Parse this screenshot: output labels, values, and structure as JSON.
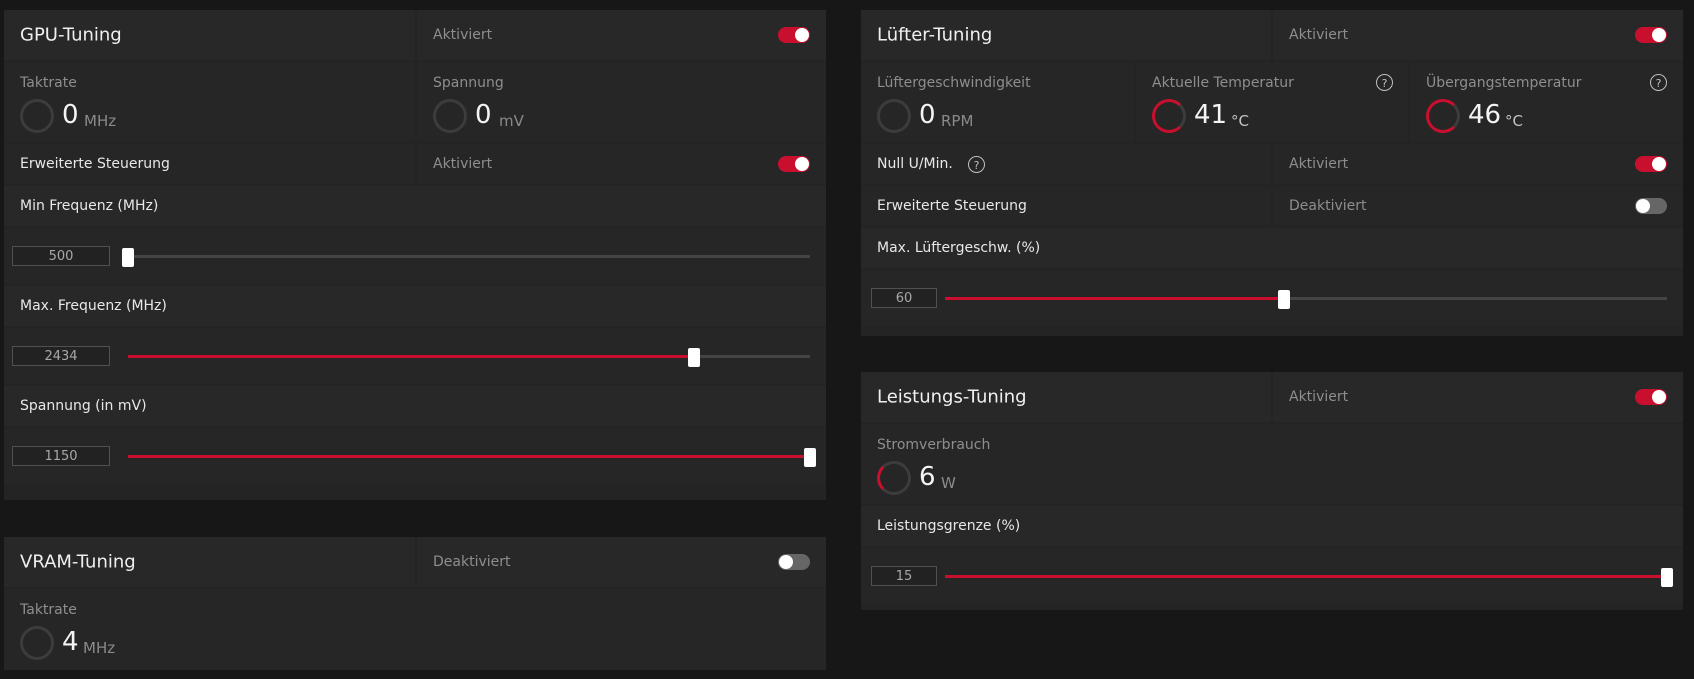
{
  "gpu": {
    "title": "GPU-Tuning",
    "status": "Aktiviert",
    "clock": {
      "label": "Taktrate",
      "value": "0",
      "unit": "MHz"
    },
    "voltage": {
      "label": "Spannung",
      "value": "0",
      "unit": "mV"
    },
    "advanced": {
      "label": "Erweiterte Steuerung",
      "status": "Aktiviert"
    },
    "min_freq": {
      "label": "Min Frequenz (MHz)",
      "value": "500",
      "fill_fraction": 0.0
    },
    "max_freq": {
      "label": "Max. Frequenz (MHz)",
      "value": "2434",
      "fill_fraction": 0.83
    },
    "volt_mv": {
      "label": "Spannung (in mV)",
      "value": "1150",
      "fill_fraction": 1.0
    }
  },
  "vram": {
    "title": "VRAM-Tuning",
    "status": "Deaktiviert",
    "clock": {
      "label": "Taktrate",
      "value": "4",
      "unit": "MHz"
    }
  },
  "fan": {
    "title": "Lüfter-Tuning",
    "status": "Aktiviert",
    "speed": {
      "label": "Lüftergeschwindigkeit",
      "value": "0",
      "unit": "RPM"
    },
    "temp": {
      "label": "Aktuelle Temperatur",
      "value": "41",
      "unit": "°C"
    },
    "junction": {
      "label": "Übergangstemperatur",
      "value": "46",
      "unit": "°C"
    },
    "zero_rpm": {
      "label": "Null U/Min.",
      "status": "Aktiviert"
    },
    "advanced": {
      "label": "Erweiterte Steuerung",
      "status": "Deaktiviert"
    },
    "max_speed": {
      "label": "Max. Lüftergeschw. (%)",
      "value": "60",
      "fill_fraction": 0.47
    }
  },
  "power": {
    "title": "Leistungs-Tuning",
    "status": "Aktiviert",
    "consumption": {
      "label": "Stromverbrauch",
      "value": "6",
      "unit": "W"
    },
    "limit": {
      "label": "Leistungsgrenze (%)",
      "value": "15",
      "fill_fraction": 1.0
    }
  },
  "help_glyph": "?",
  "colors": {
    "accent": "#c8102e",
    "panel": "#242424",
    "background": "#171717"
  }
}
